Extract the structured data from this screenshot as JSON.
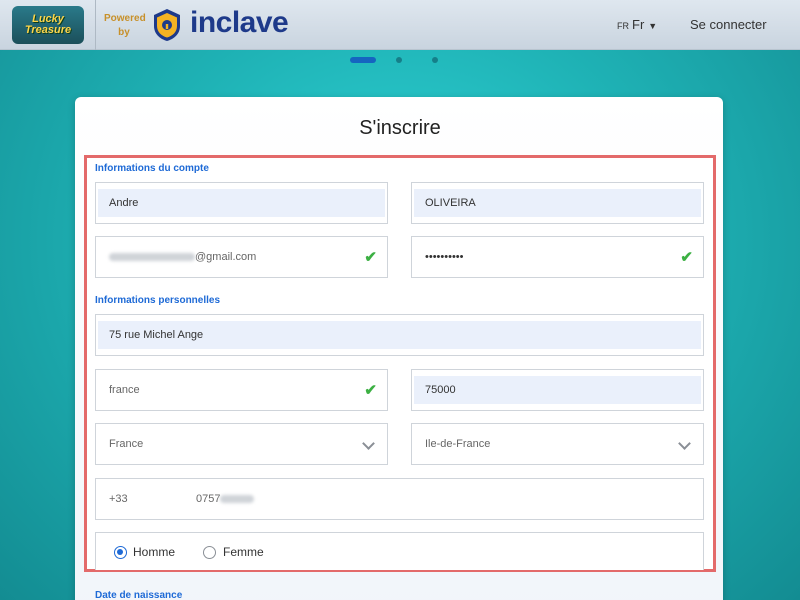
{
  "header": {
    "logo_text": "Lucky Treasure",
    "powered_label": "Powered by",
    "brand_name": "inclave",
    "lang_code": "FR",
    "lang_label": "Fr",
    "login_label": "Se connecter"
  },
  "steps": {
    "total": 3,
    "active": 1
  },
  "form": {
    "title": "S'inscrire",
    "account_section": "Informations du compte",
    "first_name": "Andre",
    "last_name": "OLIVEIRA",
    "email_suffix": "@gmail.com",
    "password": "••••••••••",
    "personal_section": "Informations personnelles",
    "address": "75 rue Michel Ange",
    "city": "france",
    "postal_code": "75000",
    "country": "France",
    "region": "Ile-de-France",
    "phone_prefix": "+33",
    "phone_visible": "0757",
    "gender_male": "Homme",
    "gender_female": "Femme",
    "gender_selected": "Homme",
    "birth_section": "Date de naissance"
  },
  "colors": {
    "accent": "#1e6ad6",
    "highlight_border": "#e36a6a",
    "check": "#3cb043",
    "brand": "#1e3a8a"
  }
}
